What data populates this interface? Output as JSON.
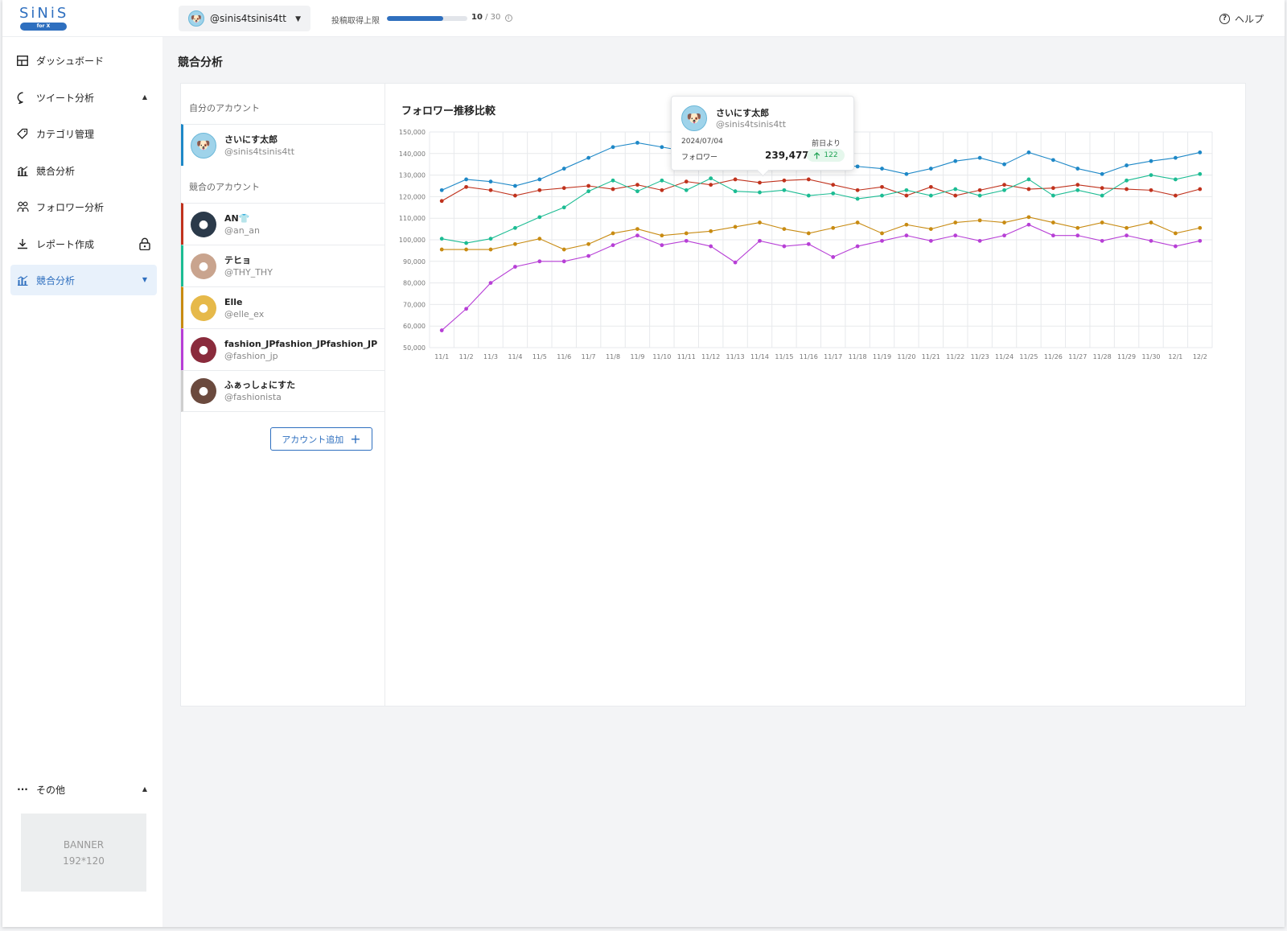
{
  "header": {
    "logo_text": "SiNiS",
    "logo_sub": "for X",
    "current_account": "@sinis4tsinis4tt",
    "quota_label": "投稿取得上限",
    "quota_used": "10",
    "quota_max": "/ 30",
    "quota_fraction": 0.7,
    "help_label": "ヘルプ"
  },
  "sidebar": {
    "items": [
      {
        "label": "ダッシュボード",
        "icon": "dashboard-icon"
      },
      {
        "label": "ツイート分析",
        "icon": "chat-bubble-icon",
        "arrow": "▲"
      },
      {
        "label": "カテゴリ管理",
        "icon": "tag-icon"
      },
      {
        "label": "競合分析",
        "icon": "bar-chart-icon"
      },
      {
        "label": "フォロワー分析",
        "icon": "followers-icon"
      },
      {
        "label": "レポート作成",
        "icon": "download-icon",
        "locked": true
      },
      {
        "label": "競合分析",
        "icon": "bar-chart-icon",
        "arrow": "▼",
        "active": true
      }
    ],
    "more_label": "その他",
    "more_arrow": "▲",
    "banner_line1": "BANNER",
    "banner_line2": "192*120"
  },
  "main": {
    "page_title": "競合分析",
    "own_section_label": "自分のアカウント",
    "competitor_section_label": "競合のアカウント",
    "own_account": {
      "name": "さいにす太郎",
      "handle": "@sinis4tsinis4tt",
      "color": "#1e88c7"
    },
    "competitors": [
      {
        "name": "AN👕",
        "handle": "@an_an",
        "color": "#c0321d"
      },
      {
        "name": "テヒョ",
        "handle": "@THY_THY",
        "color": "#1cbc93"
      },
      {
        "name": "Elle",
        "handle": "@elle_ex",
        "color": "#c88b12"
      },
      {
        "name": "fashion_JPfashion_JPfashion_JP",
        "handle": "@fashion_jp",
        "color": "#b73fd6"
      },
      {
        "name": "ふぁっしょにすた",
        "handle": "@fashionista",
        "color": "#cfcfcf"
      }
    ],
    "add_button_label": "アカウント追加",
    "chart_title": "フォロワー推移比較"
  },
  "tooltip": {
    "name": "さいにす太郎",
    "handle": "@sinis4tsinis4tt",
    "date": "2024/07/04",
    "from_label": "前日より",
    "metric_label": "フォロワー",
    "value": "239,477",
    "delta": "122",
    "delta_icon": "arrow-up-icon"
  },
  "chart_data": {
    "type": "line",
    "title": "フォロワー推移比較",
    "xlabel": "",
    "ylabel": "",
    "ylim": [
      50000,
      150000
    ],
    "yticks": [
      "50,000",
      "60,000",
      "70,000",
      "80,000",
      "90,000",
      "100,000",
      "110,000",
      "120,000",
      "130,000",
      "140,000",
      "150,000"
    ],
    "grid": true,
    "categories": [
      "11/1",
      "11/2",
      "11/3",
      "11/4",
      "11/5",
      "11/6",
      "11/7",
      "11/8",
      "11/9",
      "11/10",
      "11/11",
      "11/12",
      "11/13",
      "11/14",
      "11/15",
      "11/16",
      "11/17",
      "11/18",
      "11/19",
      "11/20",
      "11/21",
      "11/22",
      "11/23",
      "11/24",
      "11/25",
      "11/26",
      "11/27",
      "11/28",
      "11/29",
      "11/30",
      "12/1",
      "12/2"
    ],
    "series": [
      {
        "name": "さいにす太郎",
        "color": "#1e88c7",
        "values": [
          123000,
          128000,
          127000,
          125000,
          128000,
          133000,
          138000,
          143000,
          145000,
          143000,
          141000,
          140000,
          139000,
          138000,
          137000,
          136000,
          135000,
          134000,
          133000,
          130500,
          133000,
          136500,
          138000,
          135000,
          140500,
          137000,
          133000,
          130500,
          134500,
          136500,
          138000,
          140500
        ]
      },
      {
        "name": "AN👕",
        "color": "#c0321d",
        "values": [
          118000,
          124500,
          123000,
          120500,
          123000,
          124000,
          125000,
          123500,
          125500,
          123000,
          127000,
          125500,
          128000,
          126500,
          127500,
          128000,
          125500,
          123000,
          124500,
          120500,
          124500,
          120500,
          123000,
          125500,
          123500,
          124000,
          125500,
          124000,
          123500,
          123000,
          120500,
          123500
        ]
      },
      {
        "name": "テヒョ",
        "color": "#1cbc93",
        "values": [
          100500,
          98500,
          100500,
          105500,
          110500,
          115000,
          122500,
          127500,
          122500,
          127500,
          123000,
          128500,
          122500,
          122000,
          123000,
          120500,
          121500,
          119000,
          120500,
          123000,
          120500,
          123500,
          120500,
          123000,
          128000,
          120500,
          123000,
          120500,
          127500,
          130000,
          128000,
          130500
        ]
      },
      {
        "name": "Elle",
        "color": "#c88b12",
        "values": [
          95500,
          95500,
          95500,
          98000,
          100500,
          95500,
          98000,
          103000,
          105000,
          102000,
          103000,
          104000,
          106000,
          108000,
          105000,
          103000,
          105500,
          108000,
          103000,
          107000,
          105000,
          108000,
          109000,
          108000,
          110500,
          108000,
          105500,
          108000,
          105500,
          108000,
          103000,
          105500
        ]
      },
      {
        "name": "fashion_JPfashion_JPfashion_JP",
        "color": "#b73fd6",
        "values": [
          58000,
          68000,
          80000,
          87500,
          90000,
          90000,
          92500,
          97500,
          102000,
          97500,
          99500,
          97000,
          89500,
          99500,
          97000,
          98000,
          92000,
          97000,
          99500,
          102000,
          99500,
          102000,
          99500,
          102000,
          107000,
          102000,
          102000,
          99500,
          102000,
          99500,
          97000,
          99500
        ]
      }
    ]
  }
}
